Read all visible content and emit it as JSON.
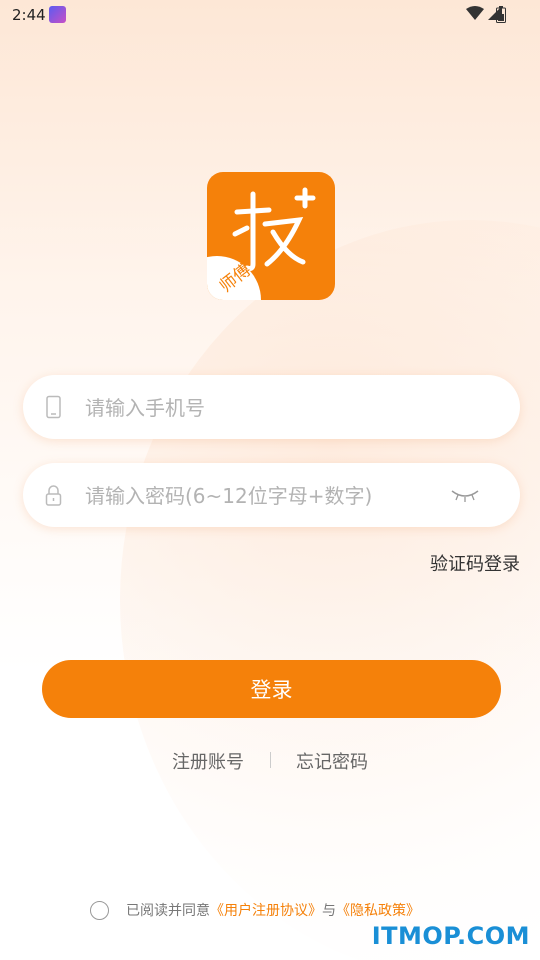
{
  "status_bar": {
    "time": "2:44"
  },
  "logo": {
    "badge_text": "师傅"
  },
  "phone_field": {
    "placeholder": "请输入手机号",
    "value": ""
  },
  "password_field": {
    "placeholder": "请输入密码(6~12位字母+数字)",
    "value": ""
  },
  "sms_login_label": "验证码登录",
  "login_button_label": "登录",
  "links": {
    "register": "注册账号",
    "forgot": "忘记密码"
  },
  "agreement": {
    "prefix": "已阅读并同意",
    "user_agreement": "《用户注册协议》",
    "conjunction": "与",
    "privacy_policy": "《隐私政策》"
  },
  "watermark": "ITMOP.COM",
  "colors": {
    "accent": "#f5810a",
    "watermark": "#1a8fd6"
  }
}
